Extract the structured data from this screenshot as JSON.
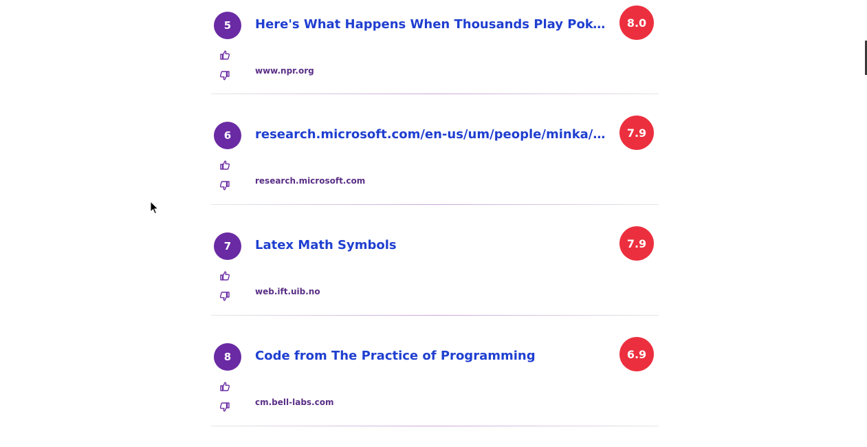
{
  "items": [
    {
      "rank": "5",
      "title": "Here's What Happens When Thousands Play Pokemon To...",
      "score": "8.0",
      "domain": "www.npr.org"
    },
    {
      "rank": "6",
      "title": "research.microsoft.com/en-us/um/people/minka/paper...",
      "score": "7.9",
      "domain": "research.microsoft.com"
    },
    {
      "rank": "7",
      "title": "Latex Math Symbols",
      "score": "7.9",
      "domain": "web.ift.uib.no"
    },
    {
      "rank": "8",
      "title": "Code from The Practice of Programming",
      "score": "6.9",
      "domain": "cm.bell-labs.com"
    }
  ],
  "icons": {
    "upvote": "thumbs-up-icon",
    "downvote": "thumbs-down-icon",
    "cursor": "mouse-pointer-icon"
  },
  "colors": {
    "rank_badge": "#6a2aa3",
    "score_badge": "#ec2f3e",
    "title_link": "#1f3fd0",
    "domain_text": "#5a2f86"
  }
}
